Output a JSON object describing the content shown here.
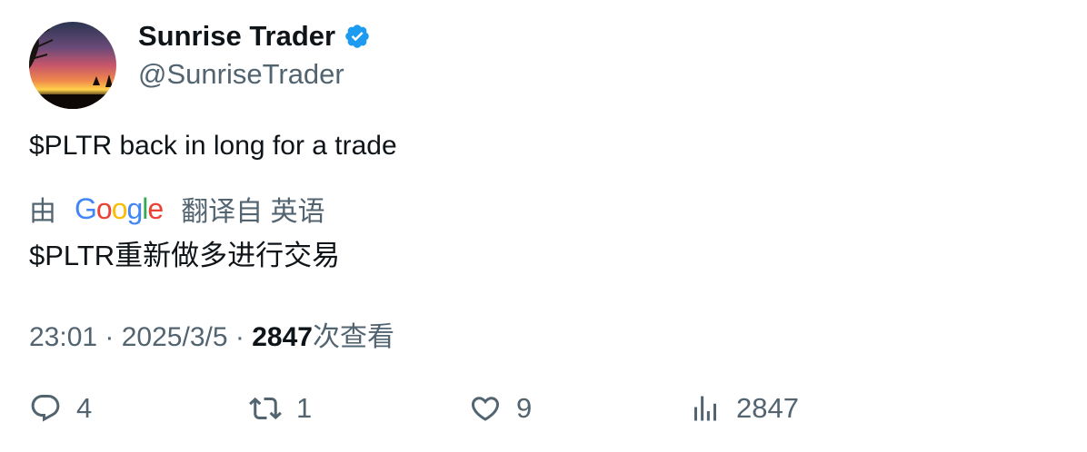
{
  "author": {
    "display_name": "Sunrise Trader",
    "handle": "@SunriseTrader",
    "verified_icon": "verified-badge-icon",
    "verified_color": "#1d9bf0"
  },
  "tweet": {
    "text": "$PLTR back in long for a trade"
  },
  "translation": {
    "prefix": "由",
    "provider_logo": "Google",
    "suffix": "翻译自 英语",
    "text": "$PLTR重新做多进行交易"
  },
  "meta": {
    "time": "23:01",
    "separator": "·",
    "date": "2025/3/5",
    "view_count": "2847",
    "views_label": "次查看"
  },
  "actions": {
    "reply_count": "4",
    "retweet_count": "1",
    "like_count": "9",
    "views_count": "2847"
  },
  "colors": {
    "text_primary": "#0f1419",
    "text_secondary": "#536471",
    "accent": "#1d9bf0"
  }
}
